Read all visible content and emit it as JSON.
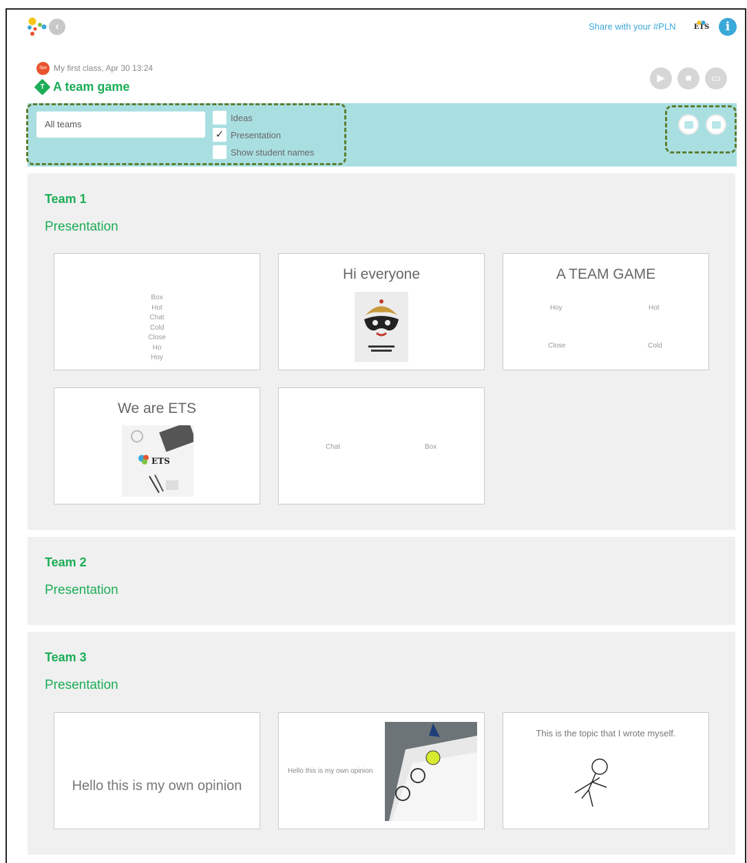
{
  "header": {
    "share_text": "Share with your #PLN",
    "ets_icon_label": "ETS",
    "info_label": "i",
    "class_badge": "Spe",
    "class_line": "My first class, Apr 30 13:24",
    "game_icon_label": "T",
    "game_title": "A team game"
  },
  "filters": {
    "team_select": "All teams",
    "options": [
      {
        "label": "Ideas",
        "checked": false
      },
      {
        "label": "Presentation",
        "checked": true
      },
      {
        "label": "Show student names",
        "checked": false
      }
    ]
  },
  "teams": [
    {
      "name": "Team 1",
      "subtitle": "Presentation",
      "slides": [
        {
          "words": [
            "Box",
            "Hot",
            "Chat",
            "Cold",
            "Close",
            "Ho",
            "Hoy"
          ]
        },
        {
          "title": "Hi everyone",
          "image": "masquerade-mask-image",
          "image_caption": "Masquerade Affairs"
        },
        {
          "title": "A TEAM GAME",
          "words": [
            "Hoy",
            "Hot",
            "Close",
            "Cold"
          ]
        },
        {
          "title": "We are ETS",
          "image": "desk-workspace-image",
          "image_caption": "ETS"
        },
        {
          "words": [
            "Chat",
            "Box"
          ]
        }
      ]
    },
    {
      "name": "Team 2",
      "subtitle": "Presentation",
      "slides": []
    },
    {
      "name": "Team 3",
      "subtitle": "Presentation",
      "slides": [
        {
          "text": "Hello this is my own opinion"
        },
        {
          "text": "Hello this is my own opinion",
          "image": "feelings-worksheet-photo"
        },
        {
          "title": "This is the topic that I wrote myself.",
          "image": "stick-figure-drawing"
        }
      ]
    }
  ],
  "colors": {
    "brand_green": "#1cad57",
    "filter_bar": "#aadfe2",
    "link_blue": "#3aa8d8",
    "section_bg": "#f0f0f0",
    "highlight_dash": "#5b7d2f"
  }
}
